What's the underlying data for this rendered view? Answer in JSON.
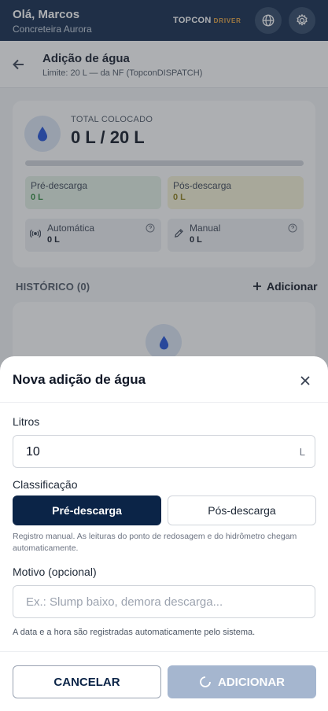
{
  "header": {
    "greeting": "Olá, Marcos",
    "company": "Concreteira Aurora",
    "brand": "TOPCON",
    "brand_suffix": "DRIVER"
  },
  "subheader": {
    "title": "Adição de água",
    "subtitle": "Limite: 20 L — da NF (TopconDISPATCH)"
  },
  "summary": {
    "total_label": "TOTAL COLOCADO",
    "total_value": "0 L / 20 L",
    "progress_fraction": 0,
    "pre": {
      "label": "Pré-descarga",
      "value": "0 L"
    },
    "pos": {
      "label": "Pós-descarga",
      "value": "0 L"
    },
    "auto": {
      "label": "Automática",
      "value": "0 L"
    },
    "manual": {
      "label": "Manual",
      "value": "0 L"
    }
  },
  "history": {
    "label": "HISTÓRICO (0)",
    "add_label": "Adicionar"
  },
  "sheet": {
    "title": "Nova adição de água",
    "liters_label": "Litros",
    "liters_value": "10",
    "liters_unit": "L",
    "class_label": "Classificação",
    "class_options": [
      "Pré-descarga",
      "Pós-descarga"
    ],
    "class_selected": "Pré-descarga",
    "help_text": "Registro manual. As leituras do ponto de redosagem e do hidrômetro chegam automaticamente.",
    "reason_label": "Motivo (opcional)",
    "reason_placeholder": "Ex.: Slump baixo, demora descarga...",
    "reason_value": "",
    "note": "A data e a hora são registradas automaticamente pelo sistema.",
    "cancel_label": "CANCELAR",
    "add_label": "ADICIONAR"
  },
  "colors": {
    "navy": "#0b2447",
    "pre_value": "#2e8b3d",
    "pos_value": "#8a7a12",
    "add_disabled": "#a5b6cf"
  },
  "icons": [
    "arrow-left-icon",
    "globe-icon",
    "gear-icon",
    "water-drop-icon",
    "info-icon",
    "signal-icon",
    "pencil-icon",
    "plus-icon",
    "close-icon",
    "spinner-icon"
  ]
}
